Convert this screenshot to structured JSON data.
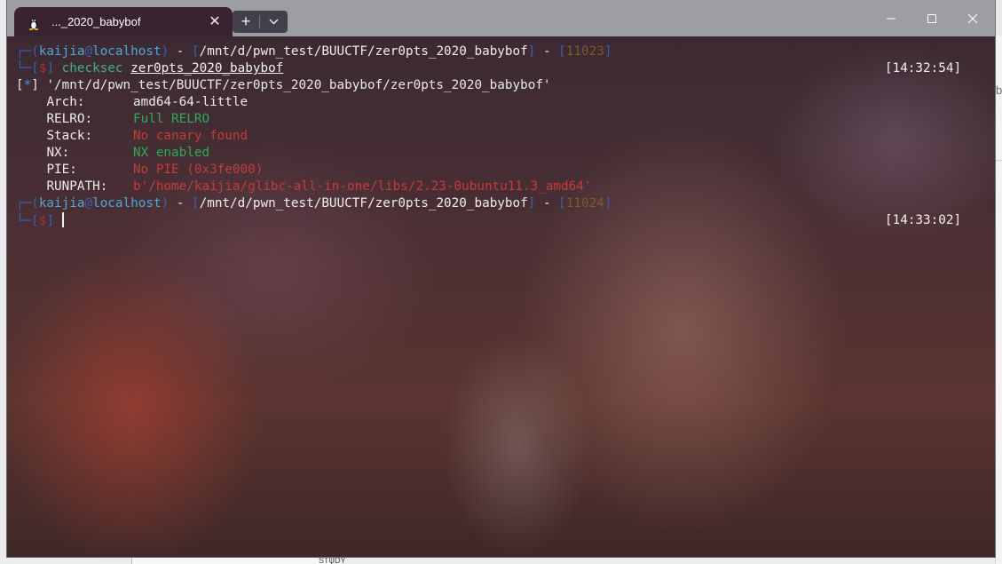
{
  "window": {
    "tab_title": "..._2020_babybof",
    "tab_icon": "linux-tux-icon",
    "controls": [
      "minimize-icon",
      "maximize-icon",
      "close-icon"
    ]
  },
  "prompt1": {
    "user": "kaijia",
    "at": "@",
    "host": "localhost",
    "dash": "-",
    "path": "/mnt/d/pwn_test/BUUCTF/zer0pts_2020_babybof",
    "num": "11023",
    "dollar": "$",
    "command": "checksec",
    "arg": "zer0pts_2020_babybof",
    "time": "[14:32:54]"
  },
  "output": {
    "star": "*",
    "file_line": "'/mnt/d/pwn_test/BUUCTF/zer0pts_2020_babybof/zer0pts_2020_babybof'",
    "rows": [
      {
        "key": "Arch:",
        "value": "amd64-64-little",
        "color": "#ececec"
      },
      {
        "key": "RELRO:",
        "value": "Full RELRO",
        "color": "#2eaa5a"
      },
      {
        "key": "Stack:",
        "value": "No canary found",
        "color": "#c53a3a"
      },
      {
        "key": "NX:",
        "value": "NX enabled",
        "color": "#2eaa5a"
      },
      {
        "key": "PIE:",
        "value": "No PIE (0x3fe000)",
        "color": "#c53a3a"
      },
      {
        "key": "RUNPATH:",
        "value": "b'/home/kaijia/glibc-all-in-one/libs/2.23-0ubuntu11.3_amd64'",
        "color": "#c53a3a"
      }
    ]
  },
  "prompt2": {
    "user": "kaijia",
    "at": "@",
    "host": "localhost",
    "dash": "-",
    "path": "/mnt/d/pwn_test/BUUCTF/zer0pts_2020_babybof",
    "num": "11024",
    "dollar": "$",
    "time": "[14:33:02]"
  },
  "background": {
    "behind_right_char": "b",
    "behind_bottom_text": "STUDY (E:)"
  }
}
